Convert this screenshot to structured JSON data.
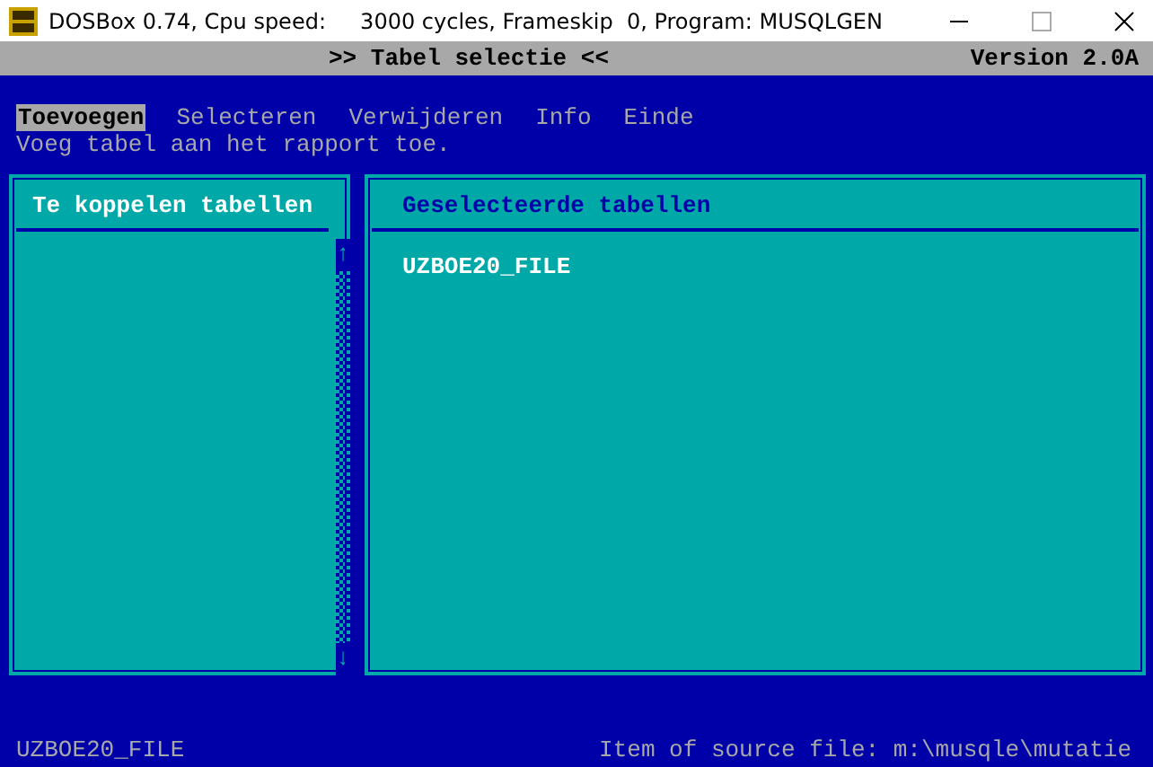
{
  "window": {
    "title": "DOSBox 0.74, Cpu speed:     3000 cycles, Frameskip  0, Program: MUSQLGEN"
  },
  "header": {
    "title": ">> Tabel selectie <<",
    "version": "Version 2.0A"
  },
  "menu": [
    {
      "label": "Toevoegen",
      "selected": true
    },
    {
      "label": "Selecteren",
      "selected": false
    },
    {
      "label": "Verwijderen",
      "selected": false
    },
    {
      "label": "Info",
      "selected": false
    },
    {
      "label": "Einde",
      "selected": false
    }
  ],
  "hint": "Voeg tabel aan het rapport toe.",
  "left_panel": {
    "title": "Te koppelen tabellen",
    "active": true,
    "scroll_up": "↑",
    "scroll_down": "↓"
  },
  "right_panel": {
    "title": "Geselecteerde tabellen",
    "active": false,
    "items": [
      "UZBOE20_FILE"
    ]
  },
  "status_bar": {
    "left": "UZBOE20_FILE",
    "right": "Item of source file: m:\\musqle\\mutatie"
  }
}
